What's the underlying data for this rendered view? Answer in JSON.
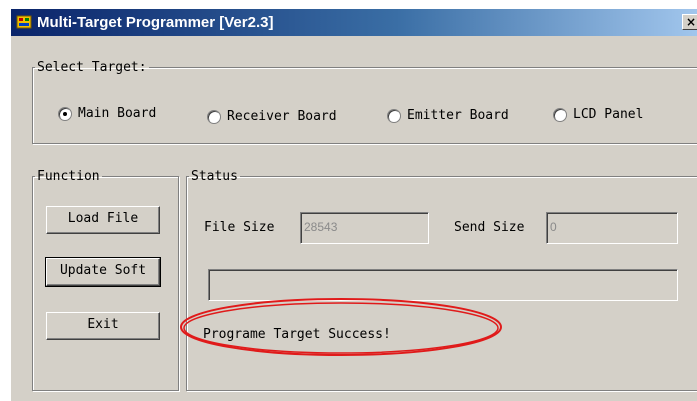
{
  "window": {
    "title": "Multi-Target Programmer [Ver2.3]",
    "close_glyph": "×"
  },
  "select_target": {
    "legend": "Select Target:",
    "options": [
      {
        "label": "Main Board",
        "checked": true
      },
      {
        "label": "Receiver Board",
        "checked": false
      },
      {
        "label": "Emitter Board",
        "checked": false
      },
      {
        "label": "LCD Panel",
        "checked": false
      }
    ]
  },
  "function": {
    "legend": "Function",
    "buttons": [
      "Load File",
      "Update Soft",
      "Exit"
    ]
  },
  "status": {
    "legend": "Status",
    "file_size_label": "File Size",
    "file_size_value": "28543",
    "send_size_label": "Send Size",
    "send_size_value": "0",
    "progress_fraction": 0,
    "message": "Programe Target Success!"
  },
  "colors": {
    "title_bar": "#0a246a",
    "dialog_face": "#d4d0c8",
    "highlight_ellipse": "#e01a1a"
  },
  "icons": [
    "app-icon",
    "close-icon",
    "radio-checked-icon",
    "radio-unchecked-icon"
  ]
}
